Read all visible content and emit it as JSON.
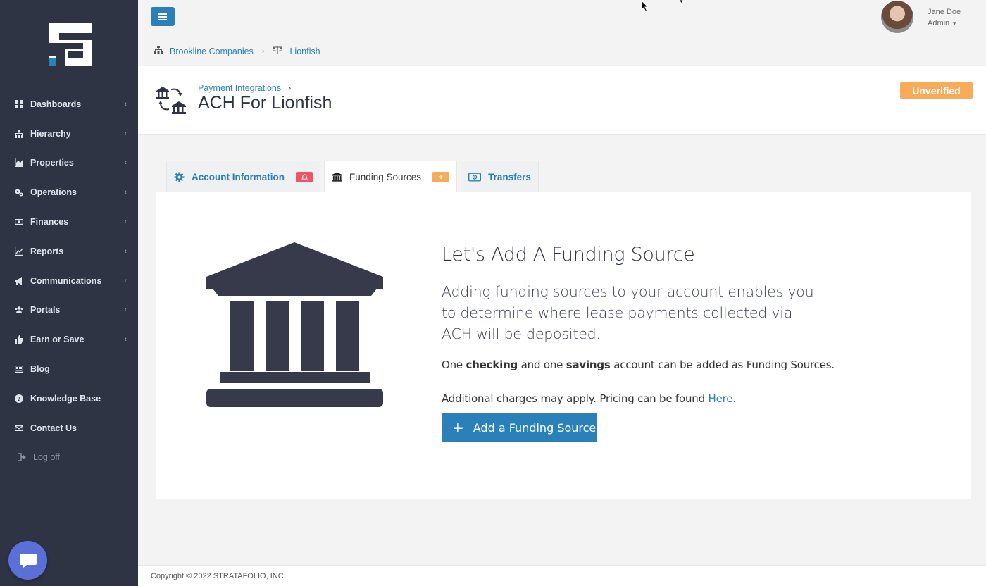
{
  "sidebar": {
    "items": [
      {
        "label": "Dashboards",
        "icon": "dashboard-icon"
      },
      {
        "label": "Hierarchy",
        "icon": "sitemap-icon"
      },
      {
        "label": "Properties",
        "icon": "chart-area-icon"
      },
      {
        "label": "Operations",
        "icon": "cogs-icon"
      },
      {
        "label": "Finances",
        "icon": "money-icon"
      },
      {
        "label": "Reports",
        "icon": "line-chart-icon"
      },
      {
        "label": "Communications",
        "icon": "bullhorn-icon"
      },
      {
        "label": "Portals",
        "icon": "users-icon"
      },
      {
        "label": "Earn or Save",
        "icon": "thumbs-up-icon"
      },
      {
        "label": "Blog",
        "icon": "newspaper-icon"
      },
      {
        "label": "Knowledge Base",
        "icon": "question-circle-icon"
      },
      {
        "label": "Contact Us",
        "icon": "envelope-icon"
      }
    ],
    "logoff": "Log off"
  },
  "header": {
    "user_name": "Jane Doe",
    "user_role": "Admin"
  },
  "breadcrumb": {
    "company": "Brookline Companies",
    "entity": "Lionfish"
  },
  "page": {
    "parent": "Payment Integrations",
    "title": "ACH For Lionfish",
    "status": "Unverified"
  },
  "tabs": [
    {
      "label": "Account Information"
    },
    {
      "label": "Funding Sources"
    },
    {
      "label": "Transfers"
    }
  ],
  "funding": {
    "title": "Let's Add A Funding Source",
    "description": "Adding funding sources to your account enables you to determine where lease payments collected via ACH will be deposited.",
    "note_pre": "One ",
    "note_checking": "checking",
    "note_mid": " and one ",
    "note_savings": "savings",
    "note_post": " account can be added as Funding Sources.",
    "charges_text": "Additional charges may apply. Pricing can be found ",
    "charges_link": "Here.",
    "button_label": "Add a Funding Source"
  },
  "footer": {
    "copyright": "Copyright © 2022 STRATAFOLIO, INC."
  },
  "colors": {
    "sidebar_bg": "#2f3445",
    "primary": "#2a80b9",
    "warning": "#f8ac59",
    "danger": "#ed5565"
  }
}
